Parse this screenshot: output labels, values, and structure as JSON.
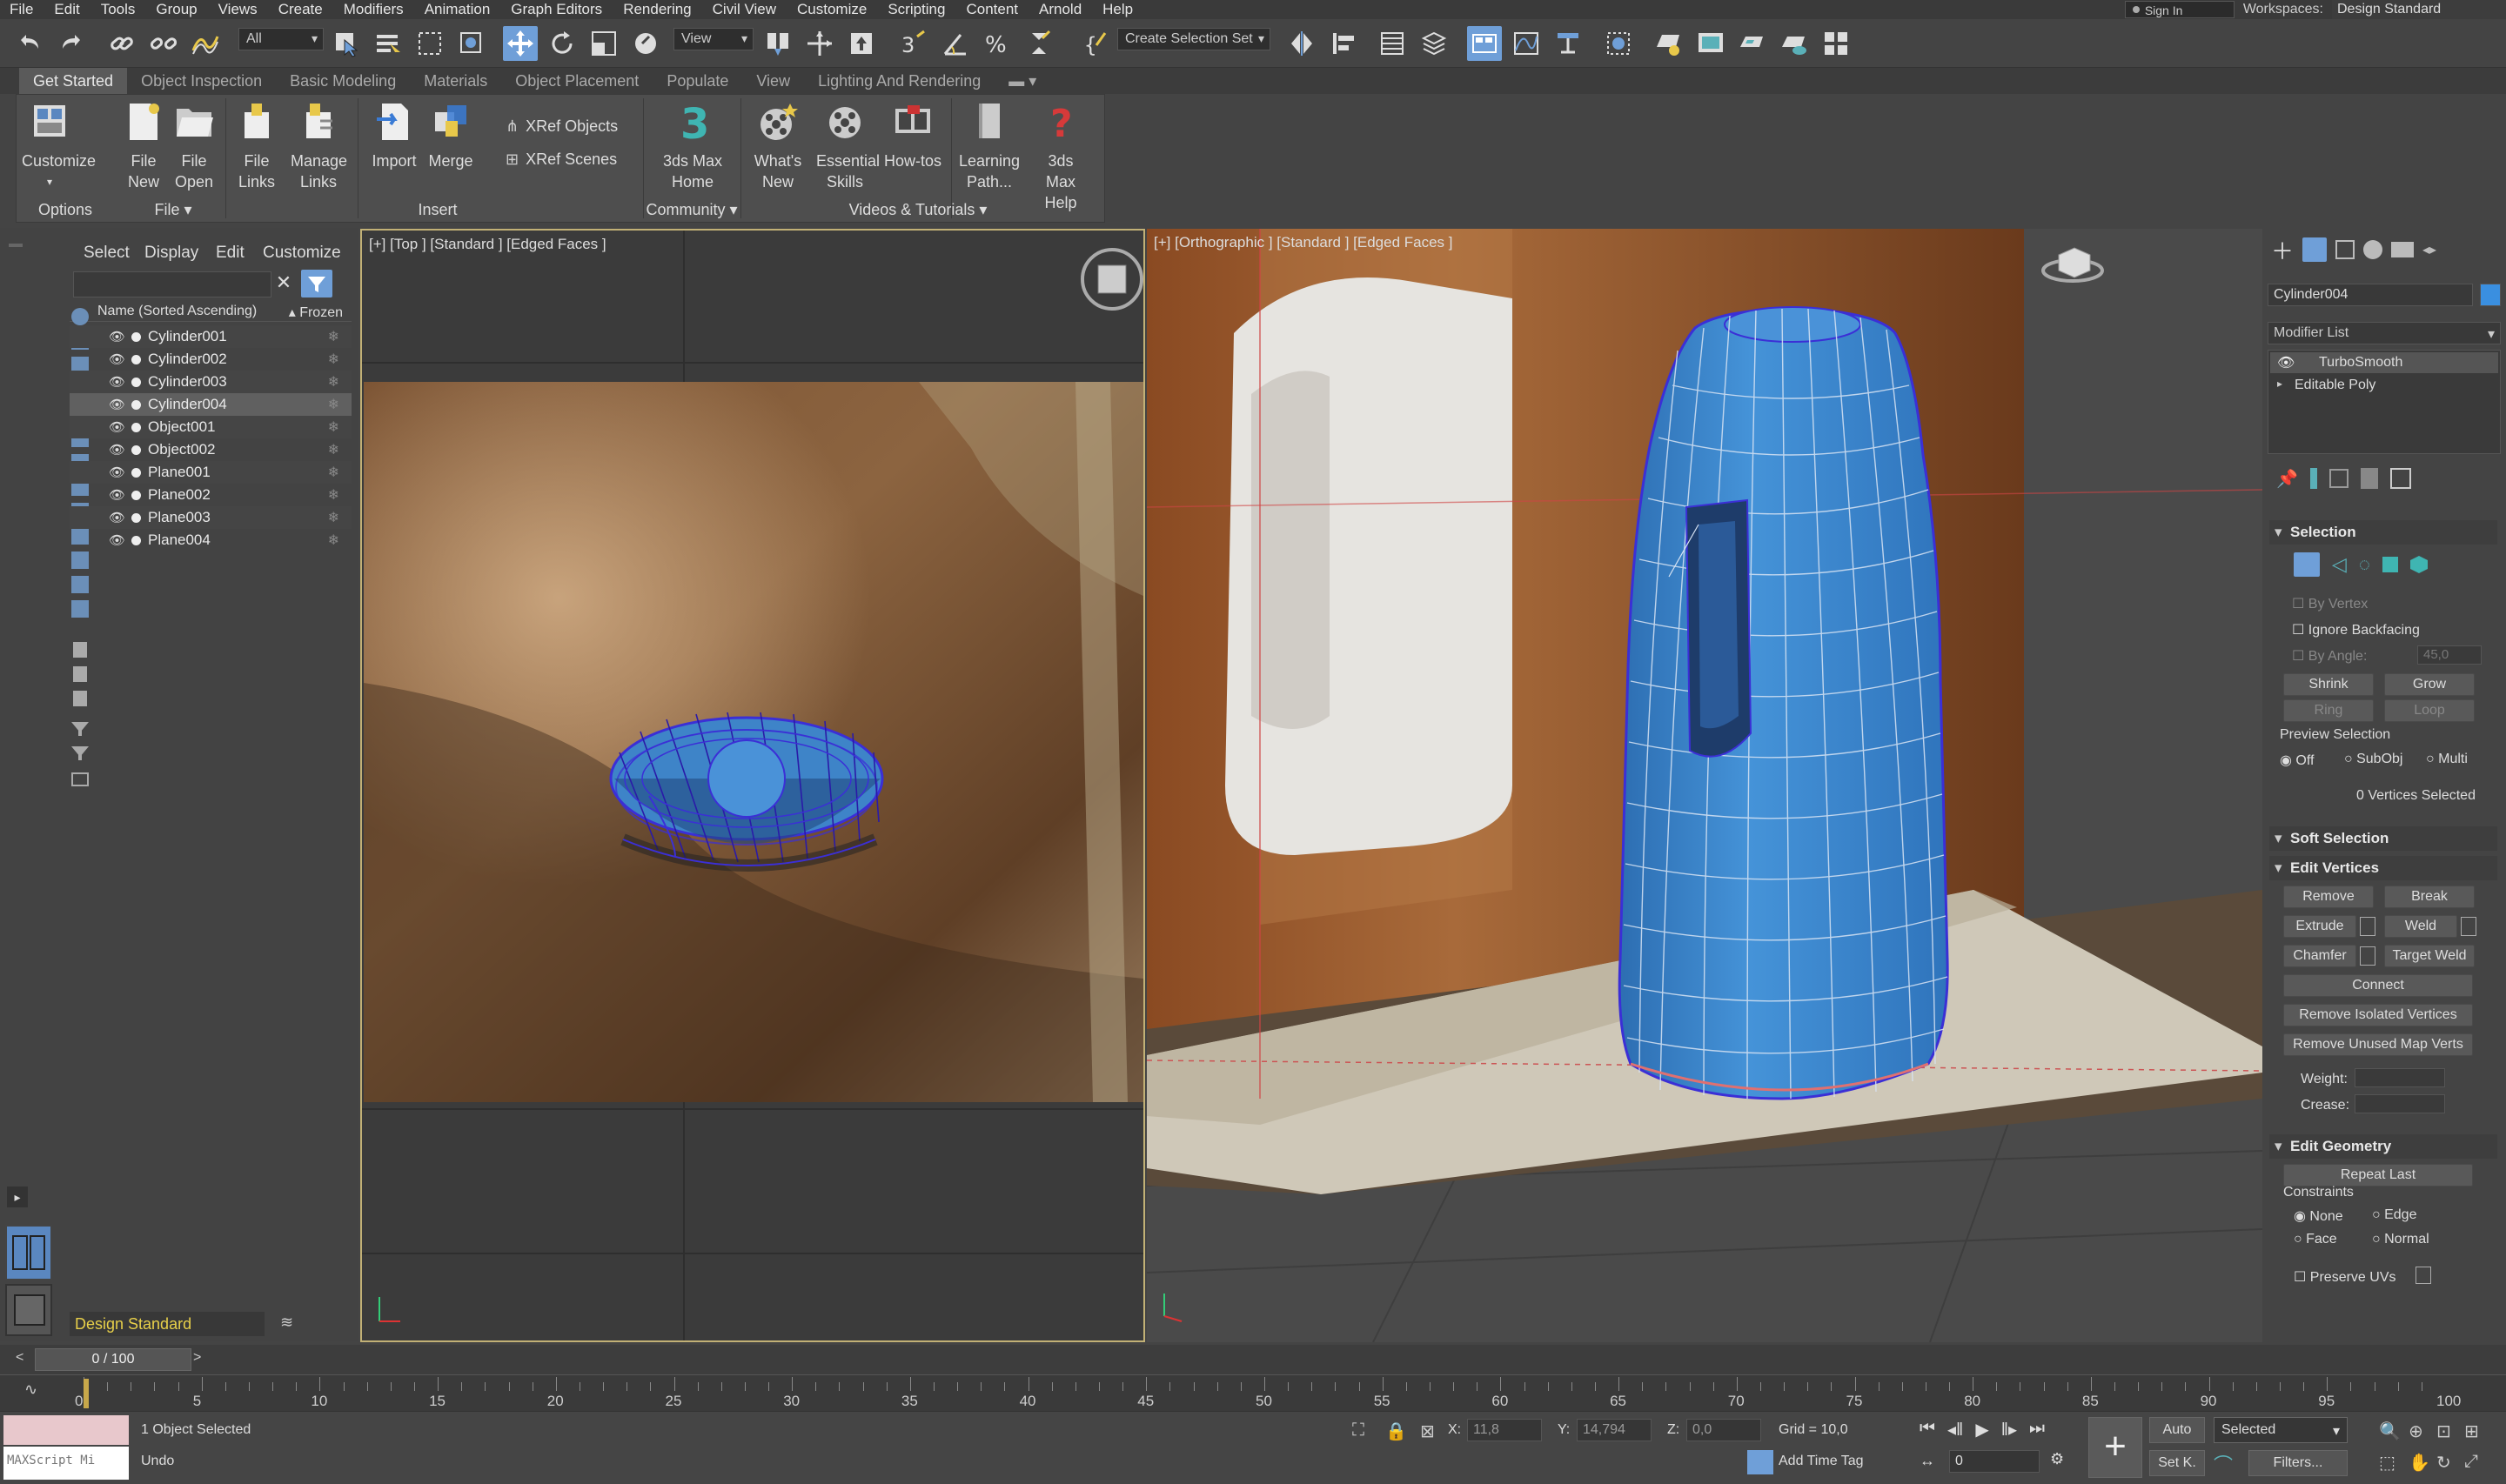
{
  "menu": [
    "File",
    "Edit",
    "Tools",
    "Group",
    "Views",
    "Create",
    "Modifiers",
    "Animation",
    "Graph Editors",
    "Rendering",
    "Civil View",
    "Customize",
    "Scripting",
    "Content",
    "Arnold",
    "Help"
  ],
  "account": {
    "signin": "Sign In",
    "workspaces_label": "Workspaces:",
    "workspace": "Design Standard"
  },
  "toolbar": {
    "filter": "All",
    "view_dropdown": "View",
    "selection_set": "Create Selection Set"
  },
  "ribbon_tabs": [
    "Get Started",
    "Object Inspection",
    "Basic Modeling",
    "Materials",
    "Object Placement",
    "Populate",
    "View",
    "Lighting And Rendering"
  ],
  "ribbon": {
    "customize": "Customize",
    "file_new": "File New",
    "file_open": "File Open",
    "file_links": "File Links",
    "manage_links": "Manage Links",
    "import": "Import",
    "merge": "Merge",
    "xref_objects": "XRef Objects",
    "xref_scenes": "XRef Scenes",
    "max_home": "3ds Max Home",
    "whats_new": "What's New",
    "essential_skills": "Essential Skills",
    "howtos": "How-tos",
    "learning_path": "Learning Path...",
    "max_help": "3ds Max Help",
    "groups": {
      "options": "Options",
      "file": "File",
      "insert": "Insert",
      "community": "Community",
      "videos": "Videos & Tutorials"
    }
  },
  "scene_explorer": {
    "tabs": [
      "Select",
      "Display",
      "Edit",
      "Customize"
    ],
    "col_name": "Name (Sorted Ascending)",
    "col_frozen": "Frozen",
    "objects": [
      "Cylinder001",
      "Cylinder002",
      "Cylinder003",
      "Cylinder004",
      "Object001",
      "Object002",
      "Plane001",
      "Plane002",
      "Plane003",
      "Plane004"
    ],
    "selected": "Cylinder004",
    "workspace": "Design Standard"
  },
  "viewports": {
    "left_label": "[+] [Top ] [Standard ] [Edged Faces ]",
    "right_label": "[+] [Orthographic ] [Standard ] [Edged Faces ]"
  },
  "command_panel": {
    "object_name": "Cylinder004",
    "modifier_list": "Modifier List",
    "stack": [
      "TurboSmooth",
      "Editable Poly"
    ],
    "selection": {
      "title": "Selection",
      "by_vertex": "By Vertex",
      "ignore_backfacing": "Ignore Backfacing",
      "by_angle": "By Angle:",
      "angle_value": "45,0",
      "shrink": "Shrink",
      "grow": "Grow",
      "ring": "Ring",
      "loop": "Loop",
      "preview": "Preview Selection",
      "preview_options": [
        "Off",
        "SubObj",
        "Multi"
      ],
      "status": "0 Vertices Selected"
    },
    "soft_selection": "Soft Selection",
    "edit_vertices": {
      "title": "Edit Vertices",
      "remove": "Remove",
      "break": "Break",
      "extrude": "Extrude",
      "weld": "Weld",
      "chamfer": "Chamfer",
      "target_weld": "Target Weld",
      "connect": "Connect",
      "remove_isolated": "Remove Isolated Vertices",
      "remove_unused": "Remove Unused Map Verts",
      "weight": "Weight:",
      "crease": "Crease:"
    },
    "edit_geometry": {
      "title": "Edit Geometry",
      "repeat_last": "Repeat Last",
      "constraints": "Constraints",
      "none": "None",
      "edge": "Edge",
      "face": "Face",
      "normal": "Normal",
      "preserve_uvs": "Preserve UVs"
    }
  },
  "timeline": {
    "frame": "0 / 100",
    "ticks": [
      "0",
      "5",
      "10",
      "15",
      "20",
      "25",
      "30",
      "35",
      "40",
      "45",
      "50",
      "55",
      "60",
      "65",
      "70",
      "75",
      "80",
      "85",
      "90",
      "95",
      "100"
    ]
  },
  "status": {
    "maxscript": "MAXScript Mi",
    "selected": "1 Object Selected",
    "undo": "Undo",
    "x_label": "X:",
    "x": "11,8",
    "y_label": "Y:",
    "y": "14,794",
    "z_label": "Z:",
    "z": "0,0",
    "grid": "Grid = 10,0",
    "add_time_tag": "Add Time Tag",
    "auto": "Auto",
    "selected_mode": "Selected",
    "set_key": "Set K.",
    "filters": "Filters...",
    "current_frame": "0"
  },
  "colors": {
    "accent": "#6f9fd8",
    "mesh": "#3e84c8",
    "wire": "#3b2fd6",
    "active_viewport": "#c2b176"
  }
}
